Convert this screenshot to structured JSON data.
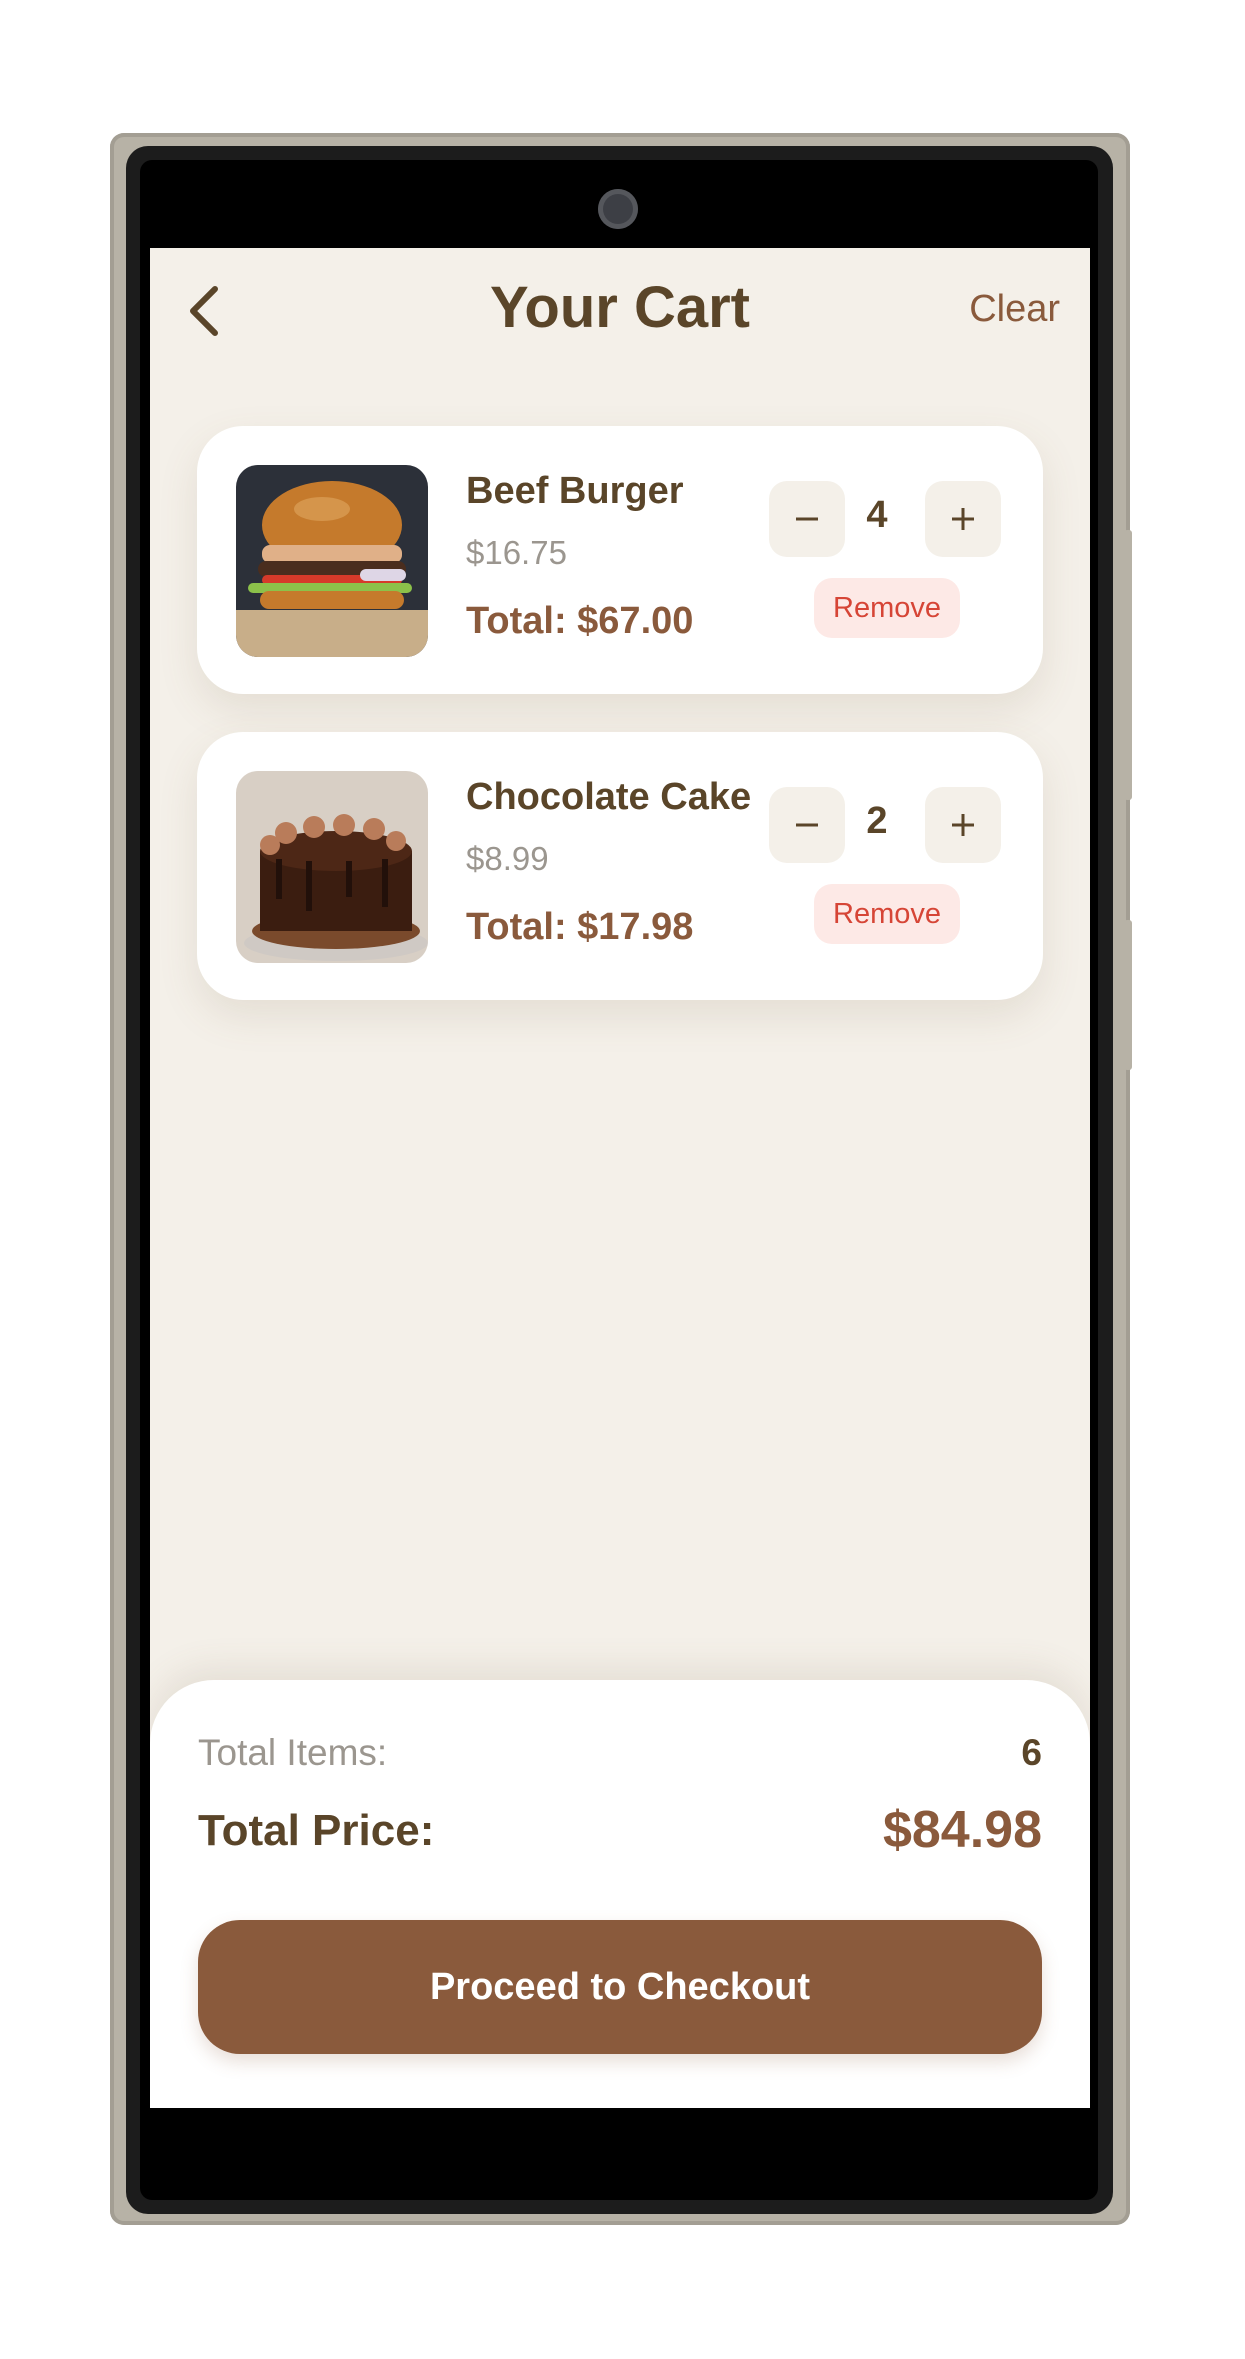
{
  "header": {
    "title": "Your Cart",
    "clear_label": "Clear"
  },
  "icons": {
    "back": "chevron-left-icon",
    "minus": "minus-icon",
    "plus": "plus-icon"
  },
  "items": [
    {
      "name": "Beef Burger",
      "price": "$16.75",
      "total": "Total: $67.00",
      "quantity": "4",
      "remove_label": "Remove",
      "image": "burger-image"
    },
    {
      "name": "Chocolate Cake",
      "price": "$8.99",
      "total": "Total: $17.98",
      "quantity": "2",
      "remove_label": "Remove",
      "image": "cake-image"
    }
  ],
  "summary": {
    "items_label": "Total Items:",
    "items_count": "6",
    "price_label": "Total Price:",
    "price_value": "$84.98",
    "checkout_label": "Proceed to Checkout"
  },
  "colors": {
    "accent": "#8a5a3c",
    "title": "#5a4529",
    "background": "#f4f0e9",
    "remove_text": "#d64536",
    "remove_bg": "#fde9e6"
  }
}
